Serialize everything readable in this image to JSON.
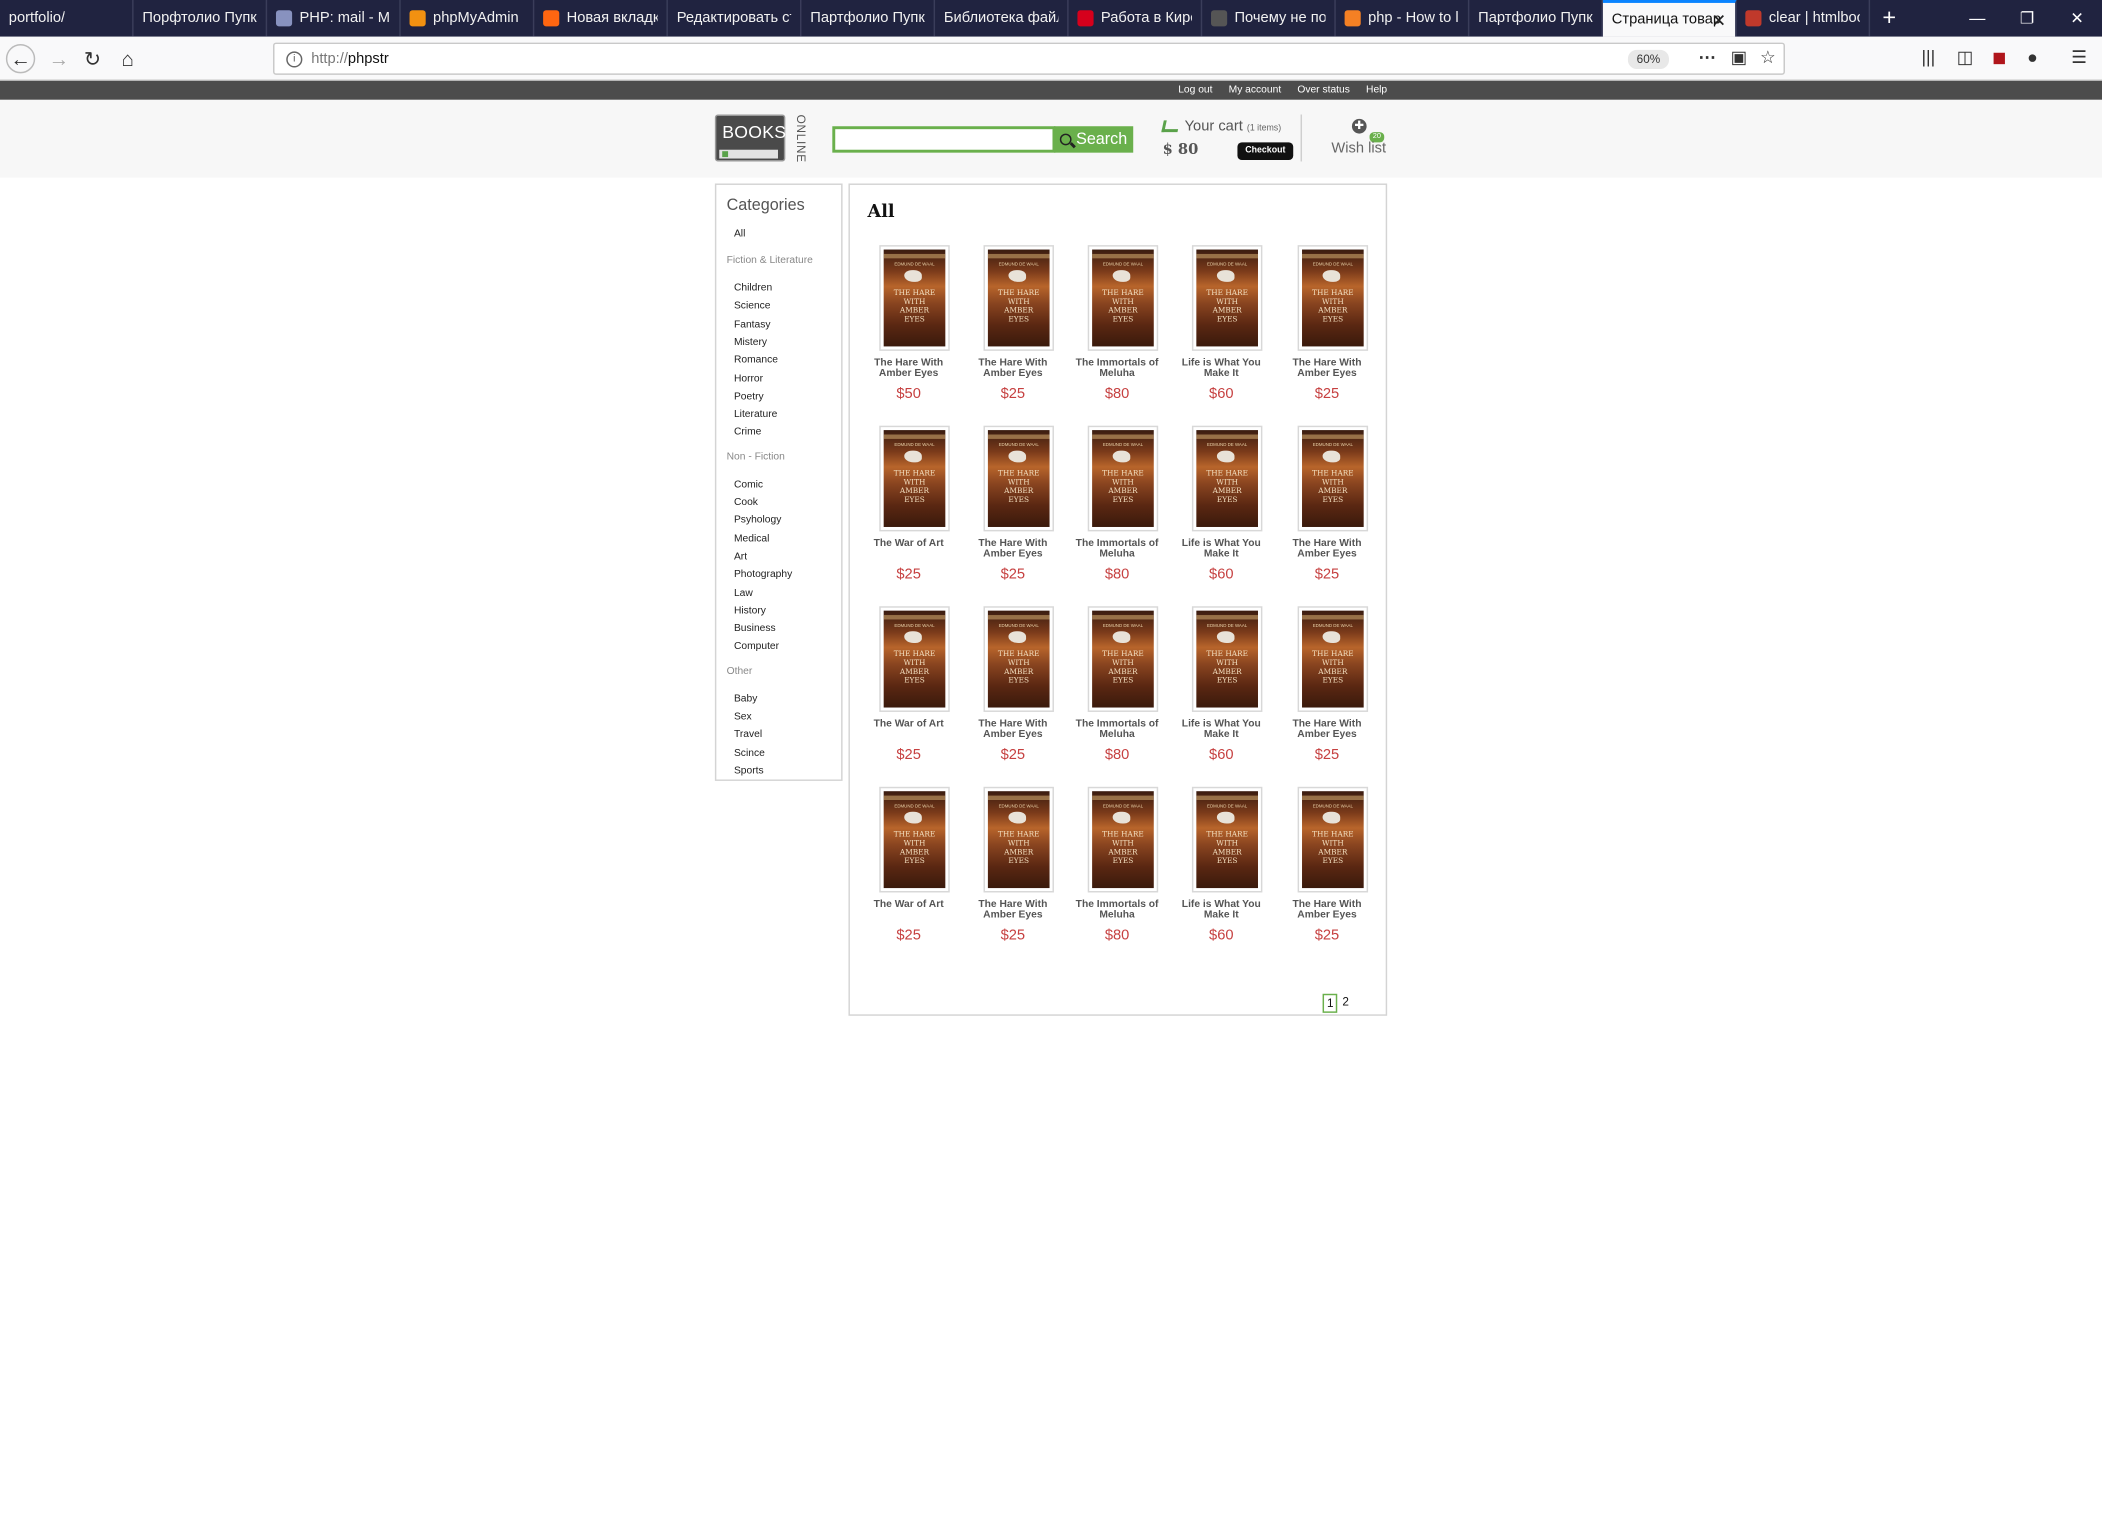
{
  "browser": {
    "tabs": [
      {
        "label": "portfolio/",
        "icon": "none-icon",
        "color": "#202340"
      },
      {
        "label": "Порфтолио Пупко",
        "icon": "none-icon",
        "color": "#202340"
      },
      {
        "label": "PHP: mail - Ma",
        "icon": "php-icon",
        "color": "#8892bf"
      },
      {
        "label": "phpMyAdmin",
        "icon": "phpmyadmin-icon",
        "color": "#f29111"
      },
      {
        "label": "Новая вкладка",
        "icon": "firefox-icon",
        "color": "#ff6611"
      },
      {
        "label": "Редактировать стр",
        "icon": "none-icon",
        "color": "#202340"
      },
      {
        "label": "Партфолио Пупко",
        "icon": "none-icon",
        "color": "#202340"
      },
      {
        "label": "Библиотека файло",
        "icon": "none-icon",
        "color": "#202340"
      },
      {
        "label": "Работа в Киро",
        "icon": "hh-icon",
        "color": "#d6001c"
      },
      {
        "label": "Почему не по",
        "icon": "toster-icon",
        "color": "#555555"
      },
      {
        "label": "php - How to l",
        "icon": "stackoverflow-icon",
        "color": "#f48024"
      },
      {
        "label": "Партфолио Пупко",
        "icon": "none-icon",
        "color": "#202340"
      },
      {
        "label": "Страница товар",
        "icon": "none-icon",
        "color": "#202340",
        "active": true
      },
      {
        "label": "clear | htmlboo",
        "icon": "htmlbook-icon",
        "color": "#c0392b"
      }
    ],
    "url_protocol": "http://",
    "url_host": "phpstr",
    "zoom": "60%"
  },
  "site": {
    "top_links": [
      "Log out",
      "My account",
      "Over status",
      "Help"
    ],
    "logo": {
      "main": "BOOKS",
      "side": "ONLINE"
    },
    "search": {
      "placeholder": "",
      "button_label": "Search"
    },
    "cart": {
      "title": "Your cart",
      "count": "(1 items)",
      "total": "$ 80",
      "checkout_label": "Checkout"
    },
    "wishlist": {
      "label": "Wish list",
      "badge": "20"
    },
    "sidebar": {
      "title": "Categories",
      "all_label": "All",
      "groups": [
        {
          "heading": "Fiction & Literature",
          "items": [
            "Children",
            "Science",
            "Fantasy",
            "Mistery",
            "Romance",
            "Horror",
            "Poetry",
            "Literature",
            "Crime"
          ]
        },
        {
          "heading": "Non - Fiction",
          "items": [
            "Comic",
            "Cook",
            "Psyhology",
            "Medical",
            "Art",
            "Photography",
            "Law",
            "History",
            "Business",
            "Computer"
          ]
        },
        {
          "heading": "Other",
          "items": [
            "Baby",
            "Sex",
            "Travel",
            "Scince",
            "Sports"
          ]
        }
      ]
    },
    "main": {
      "title": "All",
      "cover": {
        "author": "EDMUND DE WAAL",
        "title_lines": [
          "THE HARE",
          "WITH",
          "AMBER",
          "EYES"
        ]
      },
      "products": [
        {
          "name": "The Hare With Amber Eyes",
          "price": "$50"
        },
        {
          "name": "The Hare With Amber Eyes",
          "price": "$25"
        },
        {
          "name": "The Immortals of Meluha",
          "price": "$80"
        },
        {
          "name": "Life is What You Make It",
          "price": "$60"
        },
        {
          "name": "The Hare With Amber Eyes",
          "price": "$25"
        },
        {
          "name": "The War of Art",
          "price": "$25"
        },
        {
          "name": "The Hare With Amber Eyes",
          "price": "$25"
        },
        {
          "name": "The Immortals of Meluha",
          "price": "$80"
        },
        {
          "name": "Life is What You Make It",
          "price": "$60"
        },
        {
          "name": "The Hare With Amber Eyes",
          "price": "$25"
        },
        {
          "name": "The War of Art",
          "price": "$25"
        },
        {
          "name": "The Hare With Amber Eyes",
          "price": "$25"
        },
        {
          "name": "The Immortals of Meluha",
          "price": "$80"
        },
        {
          "name": "Life is What You Make It",
          "price": "$60"
        },
        {
          "name": "The Hare With Amber Eyes",
          "price": "$25"
        },
        {
          "name": "The War of Art",
          "price": "$25"
        },
        {
          "name": "The Hare With Amber Eyes",
          "price": "$25"
        },
        {
          "name": "The Immortals of Meluha",
          "price": "$80"
        },
        {
          "name": "Life is What You Make It",
          "price": "$60"
        },
        {
          "name": "The Hare With Amber Eyes",
          "price": "$25"
        }
      ],
      "pages": [
        "1",
        "2"
      ],
      "current_page": "1"
    },
    "colors": {
      "accent": "#6ab04c",
      "price": "#c64040",
      "topbar": "#4c4c4c"
    }
  }
}
